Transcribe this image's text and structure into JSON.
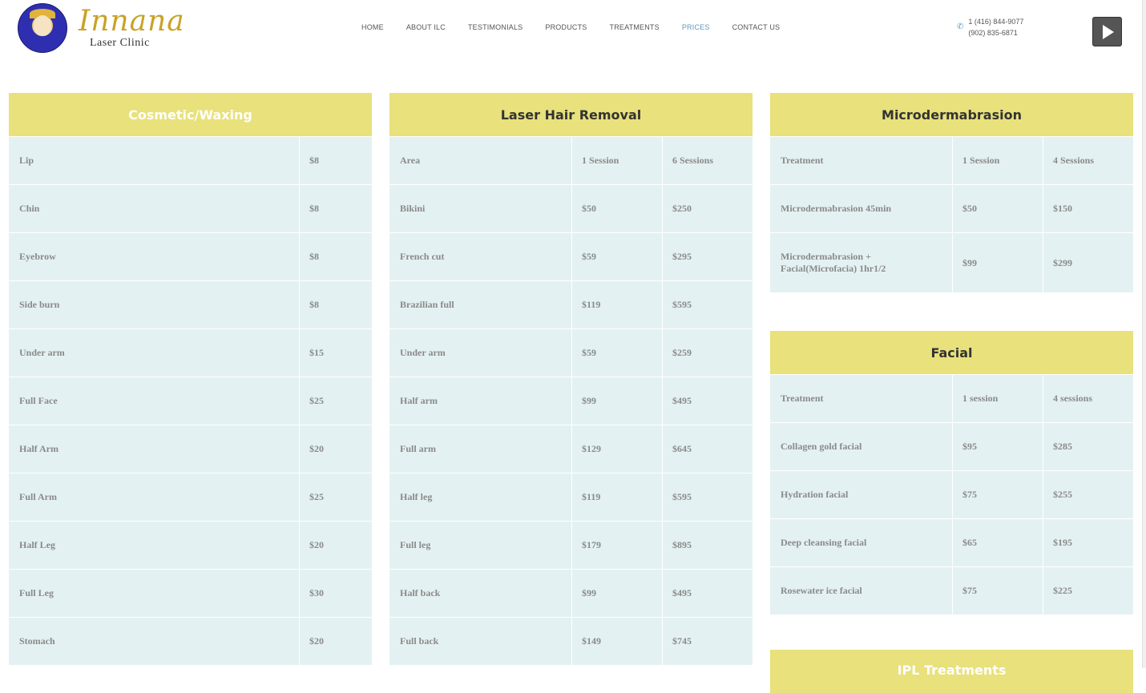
{
  "header": {
    "logo_name": "Innana",
    "logo_sub": "Laser Clinic",
    "nav": [
      {
        "label": "HOME",
        "active": false
      },
      {
        "label": "ABOUT ILC",
        "active": false
      },
      {
        "label": "TESTIMONIALS",
        "active": false
      },
      {
        "label": "PRODUCTS",
        "active": false
      },
      {
        "label": "TREATMENTS",
        "active": false
      },
      {
        "label": "PRICES",
        "active": true
      },
      {
        "label": "CONTACT US",
        "active": false
      }
    ],
    "phone_1": "1 (416) 844-9077",
    "phone_2": "(902) 835-6871",
    "phone_icon": "phone-icon",
    "play_icon": "play-icon"
  },
  "colors": {
    "header_yellow": "#e8e17c",
    "cell_bg": "#e4f1f2",
    "nav_active": "#5b9bbf"
  },
  "cosmetic": {
    "title": "Cosmetic/Waxing",
    "rows": [
      [
        "Lip",
        "$8"
      ],
      [
        "Chin",
        "$8"
      ],
      [
        "Eyebrow",
        "$8"
      ],
      [
        "Side burn",
        "$8"
      ],
      [
        "Under arm",
        "$15"
      ],
      [
        "Full Face",
        "$25"
      ],
      [
        "Half Arm",
        "$20"
      ],
      [
        "Full Arm",
        "$25"
      ],
      [
        "Half Leg",
        "$20"
      ],
      [
        "Full Leg",
        "$30"
      ],
      [
        "Stomach",
        "$20"
      ]
    ]
  },
  "laser": {
    "title": "Laser Hair Removal",
    "header": [
      "Area",
      "1 Session",
      "6 Sessions"
    ],
    "rows": [
      [
        "Bikini",
        "$50",
        "$250"
      ],
      [
        "French cut",
        "$59",
        "$295"
      ],
      [
        "Brazilian full",
        "$119",
        "$595"
      ],
      [
        "Under arm",
        "$59",
        "$259"
      ],
      [
        "Half arm",
        "$99",
        "$495"
      ],
      [
        "Full arm",
        "$129",
        "$645"
      ],
      [
        "Half leg",
        "$119",
        "$595"
      ],
      [
        "Full leg",
        "$179",
        "$895"
      ],
      [
        "Half back",
        "$99",
        "$495"
      ],
      [
        "Full back",
        "$149",
        "$745"
      ]
    ]
  },
  "micro": {
    "title": "Microdermabrasion",
    "header": [
      "Treatment",
      "1 Session",
      "4 Sessions"
    ],
    "rows": [
      [
        "Microdermabrasion 45min",
        "$50",
        "$150"
      ],
      [
        "Microdermabrasion + Facial(Microfacia) 1hr1/2",
        "$99",
        "$299"
      ]
    ]
  },
  "facial": {
    "title": "Facial",
    "header": [
      "Treatment",
      "1 session",
      "4 sessions"
    ],
    "rows": [
      [
        "Collagen gold facial",
        "$95",
        "$285"
      ],
      [
        "Hydration facial",
        "$75",
        "$255"
      ],
      [
        "Deep cleansing facial",
        "$65",
        "$195"
      ],
      [
        "Rosewater ice facial",
        "$75",
        "$225"
      ]
    ]
  },
  "ipl": {
    "title": "IPL Treatments"
  }
}
